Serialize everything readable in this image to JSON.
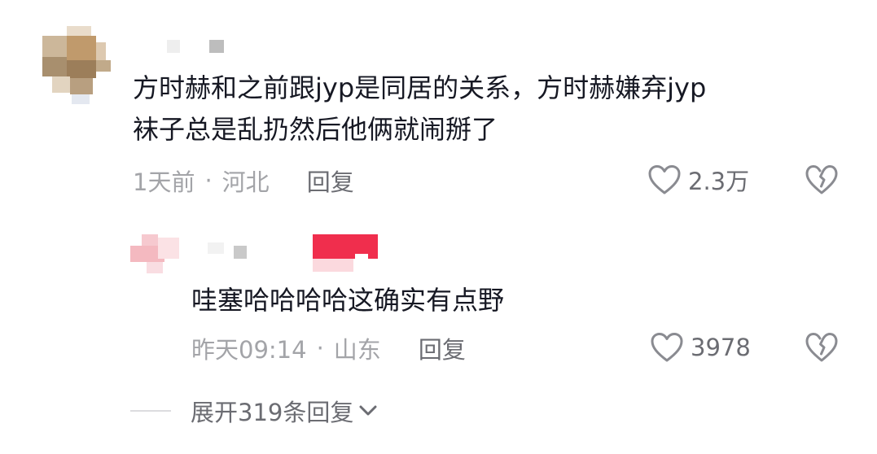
{
  "comments": [
    {
      "body_line1": "方时赫和之前跟jyp是同居的关系，方时赫嫌弃jyp",
      "body_line2": "袜子总是乱扔然后他俩就闹掰了",
      "time": "1天前",
      "location": "河北",
      "reply_label": "回复",
      "like_count": "2.3万"
    },
    {
      "body": "哇塞哈哈哈哈这确实有点野",
      "time": "昨天09:14",
      "location": "山东",
      "reply_label": "回复",
      "like_count": "3978"
    }
  ],
  "meta_separator": "·",
  "expand_replies_label": "展开319条回复",
  "icons": {
    "like": "heart-outline-icon",
    "dislike": "broken-heart-icon",
    "expand": "chevron-down-icon"
  },
  "colors": {
    "text_primary": "#161823",
    "text_secondary": "#a3a4a8",
    "action_text": "#6b6c72",
    "icon": "#8a8b91",
    "badge": "#f02e4d"
  }
}
